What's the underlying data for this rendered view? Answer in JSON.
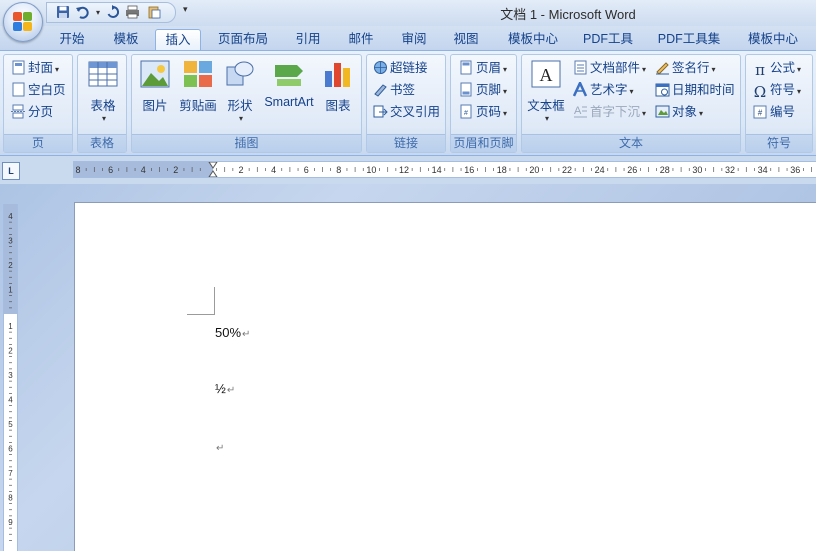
{
  "window": {
    "title": "文档 1 - Microsoft Word"
  },
  "quick_access": {
    "icons": [
      "save-icon",
      "undo-icon",
      "redo-icon",
      "print-icon",
      "clipboard-icon"
    ],
    "more": "▾"
  },
  "tabs": [
    {
      "label": "开始",
      "active": false
    },
    {
      "label": "模板",
      "active": false
    },
    {
      "label": "插入",
      "active": true
    },
    {
      "label": "页面布局",
      "active": false
    },
    {
      "label": "引用",
      "active": false
    },
    {
      "label": "邮件",
      "active": false
    },
    {
      "label": "审阅",
      "active": false
    },
    {
      "label": "视图",
      "active": false
    },
    {
      "label": "模板中心",
      "active": false
    },
    {
      "label": "PDF工具",
      "active": false
    },
    {
      "label": "PDF工具集",
      "active": false
    },
    {
      "label": "模板中心",
      "active": false
    }
  ],
  "ribbon": {
    "page_group": {
      "label": "页",
      "cover": "封面",
      "blank": "空白页",
      "break": "分页"
    },
    "table_group": {
      "label": "表格",
      "table": "表格"
    },
    "illustrations_group": {
      "label": "插图",
      "picture": "图片",
      "clipart": "剪贴画",
      "shapes": "形状",
      "smartart": "SmartArt",
      "chart": "图表"
    },
    "links_group": {
      "label": "链接",
      "hyperlink": "超链接",
      "bookmark": "书签",
      "crossref": "交叉引用"
    },
    "header_footer_group": {
      "label": "页眉和页脚",
      "header": "页眉",
      "footer": "页脚",
      "page_number": "页码"
    },
    "text_group": {
      "label": "文本",
      "textbox": "文本框",
      "quickparts": "文档部件",
      "wordart": "艺术字",
      "dropcap": "首字下沉",
      "signature": "签名行",
      "datetime": "日期和时间",
      "object": "对象"
    },
    "symbols_group": {
      "label": "符号",
      "equation": "公式",
      "symbol": "符号",
      "numbering": "编号"
    }
  },
  "ruler": {
    "toggle": "L",
    "h_labels": [
      "8",
      "6",
      "4",
      "2",
      "2",
      "4",
      "6",
      "8",
      "10",
      "12",
      "14",
      "16",
      "18",
      "20",
      "22",
      "24",
      "26",
      "28",
      "30",
      "32",
      "34",
      "36"
    ],
    "v_labels": [
      "4",
      "3",
      "2",
      "1",
      "1",
      "2",
      "3",
      "4",
      "5",
      "6",
      "7",
      "8",
      "9"
    ]
  },
  "document": {
    "paragraphs": [
      "50%",
      "½",
      ""
    ],
    "para_mark": "↵"
  },
  "colors": {
    "accent": "#15428b",
    "ribbon_bg": "#dbe7f6",
    "page": "#ffffff"
  }
}
